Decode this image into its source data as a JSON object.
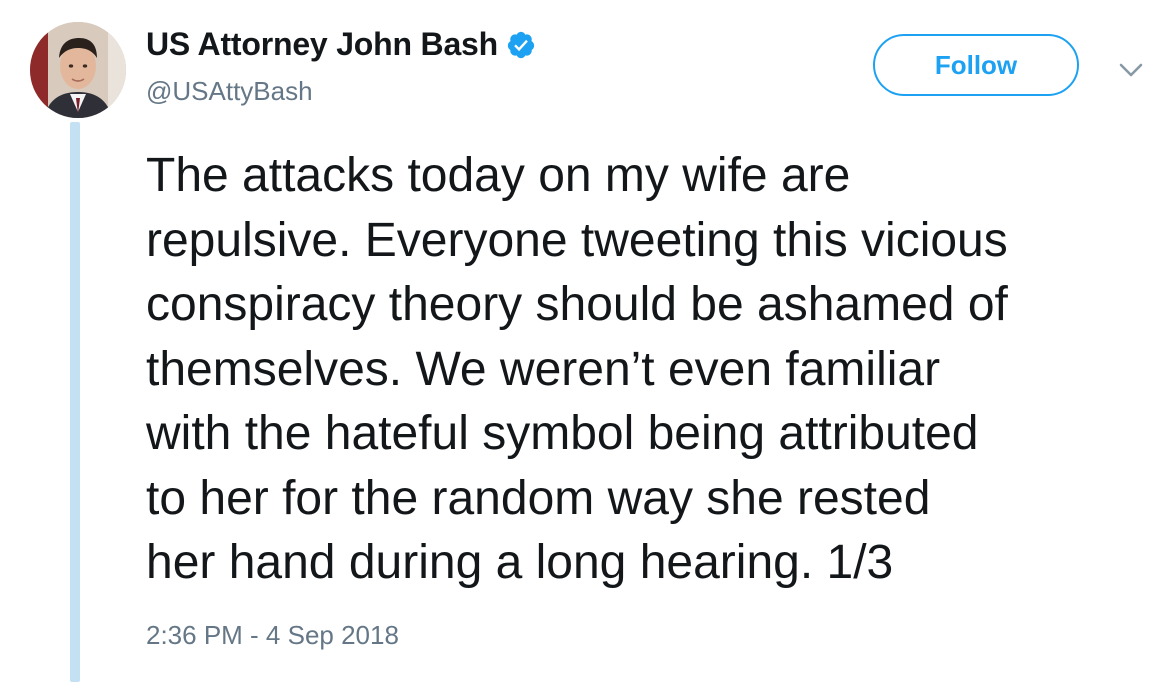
{
  "author": {
    "display_name": "US Attorney John Bash",
    "handle": "@USAttyBash",
    "verified": true,
    "avatar": "profile-photo"
  },
  "actions": {
    "follow_label": "Follow",
    "menu_icon": "chevron-down-icon"
  },
  "tweet": {
    "lines": [
      "The attacks today on my wife are",
      "repulsive. Everyone tweeting this vicious",
      "conspiracy theory should be ashamed of",
      "themselves. We weren’t even familiar",
      "with the hateful symbol being attributed",
      "to her for the random way she rested",
      "her hand during a long hearing. 1/3"
    ],
    "timestamp": "2:36 PM - 4 Sep 2018"
  },
  "colors": {
    "accent": "#1da1f2",
    "text": "#14171a",
    "muted": "#657786",
    "thread_line": "#c4e1f4"
  }
}
